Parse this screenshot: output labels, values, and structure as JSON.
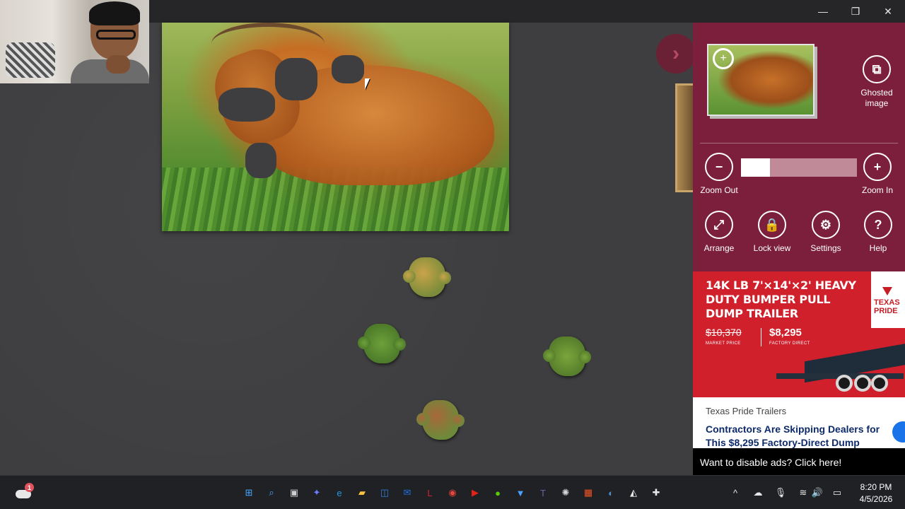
{
  "window": {
    "controls": {
      "minimize": "—",
      "maximize": "❐",
      "close": "✕"
    }
  },
  "game": {
    "collapse_glyph": "›",
    "pieces_count": 4
  },
  "panel": {
    "ghost_label": "Ghosted image",
    "zoom_out_label": "Zoom Out",
    "zoom_in_label": "Zoom In",
    "zoom_level": 0.25,
    "arrange_label": "Arrange",
    "lock_label": "Lock view",
    "settings_label": "Settings",
    "help_label": "Help",
    "icons": {
      "ghost": "⧉",
      "zoom_out": "−",
      "zoom_in": "+",
      "arrange": "⤢",
      "lock": "🔒",
      "settings": "⚙",
      "help": "?"
    }
  },
  "ad": {
    "headline": "14K LB 7'×14'×2' HEAVY DUTY BUMPER PULL DUMP TRAILER",
    "price_old": "$10,370",
    "price_old_caption": "MARKET PRICE",
    "price_new": "$8,295",
    "price_new_caption": "FACTORY DIRECT",
    "logo_text": "TEXAS PRIDE",
    "brand": "Texas Pride Trailers",
    "text": "Contractors Are Skipping Dealers for This $8,295 Factory-Direct Dump",
    "disable_text": "Want to disable ads? Click here!"
  },
  "taskbar": {
    "weather_badge": "1",
    "icons": [
      {
        "name": "start",
        "glyph": "⊞",
        "color": "#4aa3ff"
      },
      {
        "name": "search",
        "glyph": "⌕",
        "color": "#4aa3ff"
      },
      {
        "name": "task-view",
        "glyph": "▣",
        "color": "#cfcfcf"
      },
      {
        "name": "copilot",
        "glyph": "✦",
        "color": "#6b7cff"
      },
      {
        "name": "edge",
        "glyph": "e",
        "color": "#1e9be6"
      },
      {
        "name": "file-explorer",
        "glyph": "▰",
        "color": "#f5c242"
      },
      {
        "name": "store",
        "glyph": "◫",
        "color": "#2f7fe0"
      },
      {
        "name": "outlook",
        "glyph": "✉",
        "color": "#1a73e8"
      },
      {
        "name": "lastpass",
        "glyph": "L",
        "color": "#d3202f"
      },
      {
        "name": "chrome",
        "glyph": "◉",
        "color": "#e8453c"
      },
      {
        "name": "youtube",
        "glyph": "▶",
        "color": "#e62117"
      },
      {
        "name": "duo",
        "glyph": "●",
        "color": "#58cc02"
      },
      {
        "name": "sticky",
        "glyph": "▼",
        "color": "#4aa3ff"
      },
      {
        "name": "teams",
        "glyph": "T",
        "color": "#6264a7"
      },
      {
        "name": "openai",
        "glyph": "✺",
        "color": "#d8d8d8"
      },
      {
        "name": "microsoft",
        "glyph": "▦",
        "color": "#f35325"
      },
      {
        "name": "steam",
        "glyph": "◐",
        "color": "#4c8fc9"
      },
      {
        "name": "unity",
        "glyph": "◭",
        "color": "#e8e8e8"
      },
      {
        "name": "jigsaw",
        "glyph": "✚",
        "color": "#e8e8e8"
      }
    ],
    "tray": {
      "overflow": "^",
      "onedrive": "☁",
      "mic": "🎙",
      "wifi": "≋",
      "volume": "🔊",
      "battery": "▭"
    },
    "time": "8:20 PM",
    "date": "4/5/2026"
  }
}
